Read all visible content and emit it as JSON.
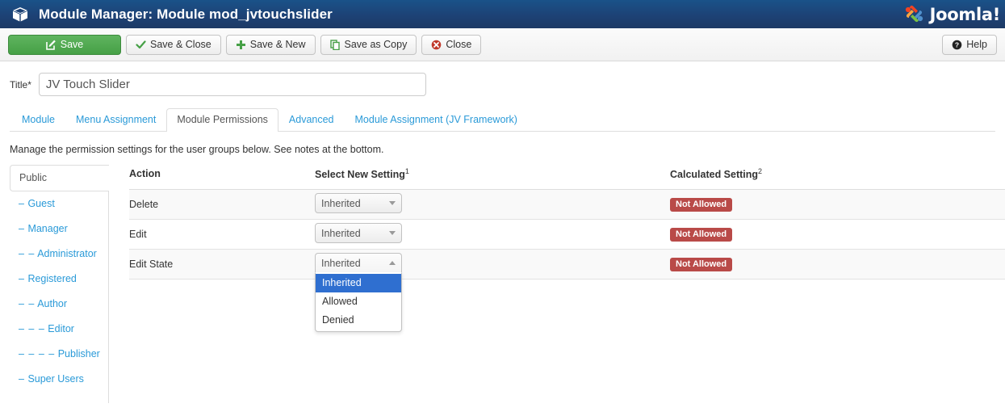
{
  "header": {
    "icon": "cube-icon",
    "title": "Module Manager: Module mod_jvtouchslider",
    "brand": "Joomla!",
    "bg_start": "#1a5289",
    "bg_end": "#1d3a66"
  },
  "toolbar": {
    "buttons": [
      {
        "label": "Save",
        "icon": "edit-square-icon",
        "style": "primary"
      },
      {
        "label": "Save & Close",
        "icon": "check-icon",
        "style": "default"
      },
      {
        "label": "Save & New",
        "icon": "plus-icon",
        "style": "default"
      },
      {
        "label": "Save as Copy",
        "icon": "copy-icon",
        "style": "default"
      },
      {
        "label": "Close",
        "icon": "close-circle-icon",
        "style": "default"
      }
    ],
    "help": {
      "label": "Help",
      "icon": "help-circle-icon"
    },
    "save_color": "#46a046"
  },
  "title_field": {
    "label": "Title",
    "required_marker": "*",
    "value": "JV Touch Slider",
    "placeholder": ""
  },
  "tabs": [
    {
      "label": "Module",
      "active": false
    },
    {
      "label": "Menu Assignment",
      "active": false
    },
    {
      "label": "Module Permissions",
      "active": true
    },
    {
      "label": "Advanced",
      "active": false
    },
    {
      "label": "Module Assignment (JV Framework)",
      "active": false
    }
  ],
  "intro_text": "Manage the permission settings for the user groups below. See notes at the bottom.",
  "group_list": [
    {
      "label": "Public",
      "prefix": "",
      "active": true
    },
    {
      "label": "Guest",
      "prefix": "–",
      "active": false
    },
    {
      "label": "Manager",
      "prefix": "–",
      "active": false
    },
    {
      "label": "Administrator",
      "prefix": "– –",
      "active": false
    },
    {
      "label": "Registered",
      "prefix": "–",
      "active": false
    },
    {
      "label": "Author",
      "prefix": "– –",
      "active": false
    },
    {
      "label": "Editor",
      "prefix": "– – –",
      "active": false
    },
    {
      "label": "Publisher",
      "prefix": "– – – –",
      "active": false
    },
    {
      "label": "Super Users",
      "prefix": "–",
      "active": false
    }
  ],
  "table": {
    "headers": {
      "action": "Action",
      "setting": "Select New Setting",
      "setting_note": "1",
      "calculated": "Calculated Setting",
      "calculated_note": "2"
    },
    "rows": [
      {
        "action": "Delete",
        "select_value": "Inherited",
        "open": false,
        "calculated": "Not Allowed"
      },
      {
        "action": "Edit",
        "select_value": "Inherited",
        "open": false,
        "calculated": "Not Allowed"
      },
      {
        "action": "Edit State",
        "select_value": "Inherited",
        "open": true,
        "calculated": "Not Allowed"
      }
    ],
    "select_options": [
      "Inherited",
      "Allowed",
      "Denied"
    ],
    "selected_option": "Inherited",
    "badge_color": "#b94a48",
    "highlight_color": "#2f6fd0"
  }
}
